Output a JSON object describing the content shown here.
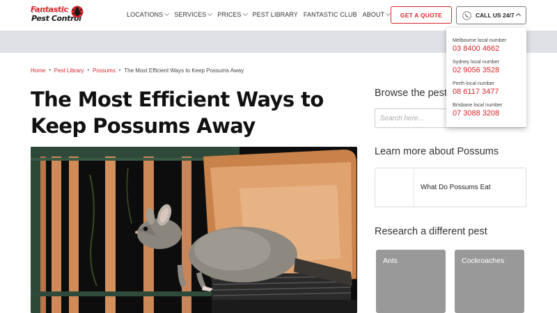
{
  "header": {
    "logo_line1": "Fantastic",
    "logo_line2": "Pest Control",
    "nav": [
      {
        "label": "LOCATIONS",
        "has_dropdown": true
      },
      {
        "label": "SERVICES",
        "has_dropdown": true
      },
      {
        "label": "PRICES",
        "has_dropdown": true
      },
      {
        "label": "PEST LIBRARY",
        "has_dropdown": false
      },
      {
        "label": "FANTASTIC CLUB",
        "has_dropdown": false
      },
      {
        "label": "ABOUT",
        "has_dropdown": true
      }
    ],
    "quote_label": "GET A QUOTE",
    "call_label": "CALL US 24/7"
  },
  "call_dropdown": [
    {
      "label": "Melbourne local number",
      "number": "03 8400 4662"
    },
    {
      "label": "Sydney local number",
      "number": "02 9056 3528"
    },
    {
      "label": "Perth local number",
      "number": "08 6117 3477"
    },
    {
      "label": "Brisbane local number",
      "number": "07 3088 3208"
    }
  ],
  "breadcrumb": {
    "items": [
      "Home",
      "Pest Library",
      "Possums"
    ],
    "current": "The Most Efficient Ways to Keep Possums Away"
  },
  "article": {
    "title": "The Most Efficient Ways to Keep Possums Away"
  },
  "sidebar": {
    "browse_heading": "Browse the pest",
    "search_placeholder": "Search here...",
    "learn_heading": "Learn more about Possums",
    "related_title": "What Do Possums Eat",
    "research_heading": "Research a different pest",
    "pests": [
      "Ants",
      "Cockroaches"
    ]
  },
  "colors": {
    "accent": "#d7262b",
    "banner": "#dfe1e7",
    "tile": "#999999"
  }
}
